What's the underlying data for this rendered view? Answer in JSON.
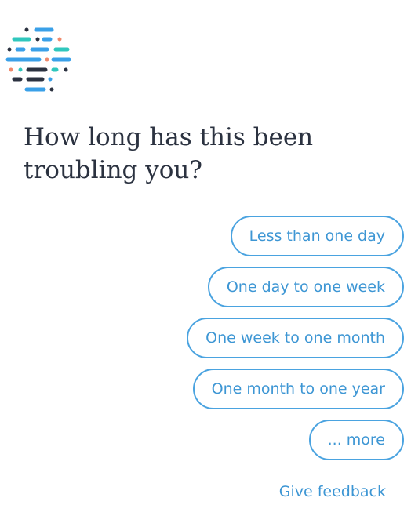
{
  "logo": {
    "icon": "brand-logo-dots-and-dashes",
    "colors": [
      "#2b3240",
      "#3aa0e8",
      "#2fc7bd",
      "#f08a6c"
    ]
  },
  "question": "How long has this been troubling you?",
  "options": [
    {
      "label": "Less than one day"
    },
    {
      "label": "One day to one week"
    },
    {
      "label": "One week to one month"
    },
    {
      "label": "One month to one year"
    },
    {
      "label": "... more"
    }
  ],
  "feedback_label": "Give feedback",
  "colors": {
    "accent": "#3d96d4",
    "border": "#4aa3e0",
    "text": "#2b3240",
    "background": "#ffffff"
  }
}
